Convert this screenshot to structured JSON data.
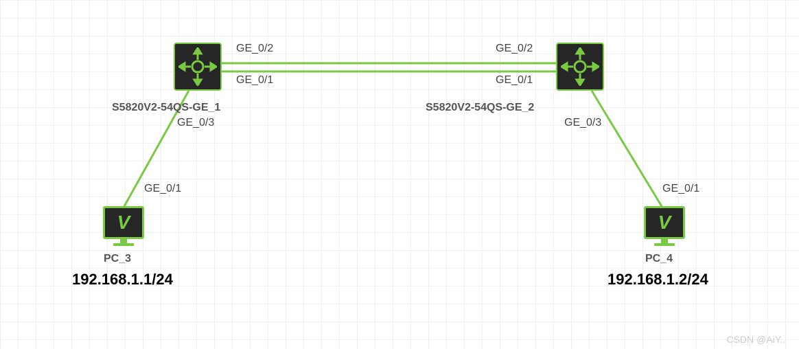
{
  "devices": {
    "switch1": {
      "name": "S5820V2-54QS-GE_1"
    },
    "switch2": {
      "name": "S5820V2-54QS-GE_2"
    },
    "pc1": {
      "name": "PC_3",
      "ip": "192.168.1.1/24"
    },
    "pc2": {
      "name": "PC_4",
      "ip": "192.168.1.2/24"
    }
  },
  "ports": {
    "s1_top": "GE_0/2",
    "s1_bot": "GE_0/1",
    "s1_down": "GE_0/3",
    "s2_top": "GE_0/2",
    "s2_bot": "GE_0/1",
    "s2_down": "GE_0/3",
    "pc1_up": "GE_0/1",
    "pc2_up": "GE_0/1"
  },
  "watermark": "CSDN @AiY.."
}
